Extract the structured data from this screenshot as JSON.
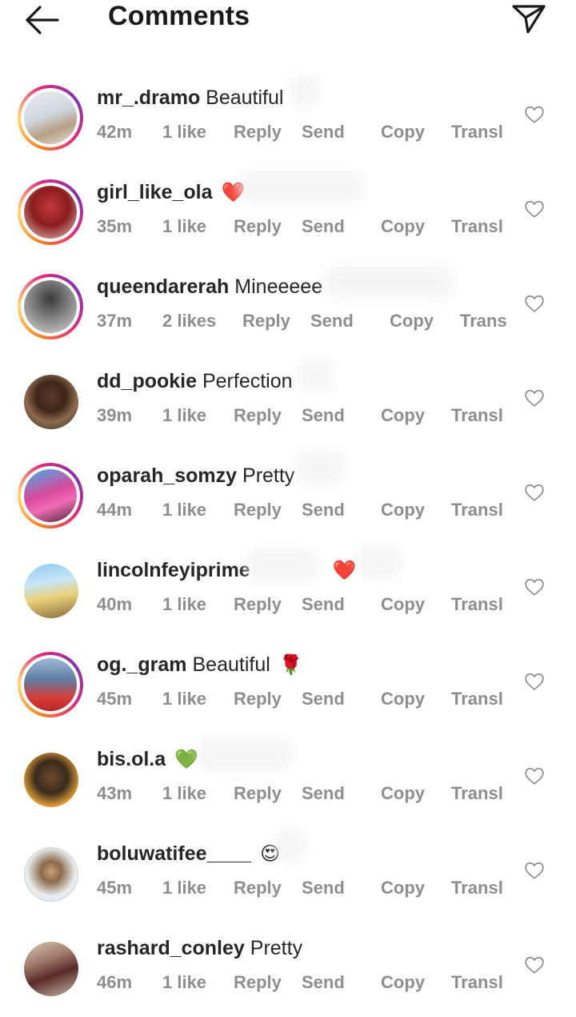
{
  "header": {
    "title": "Comments",
    "back_icon": "arrow-left-icon",
    "send_icon": "paper-plane-icon"
  },
  "actions": {
    "reply": "Reply",
    "send": "Send",
    "copy": "Copy",
    "translate": "Transl",
    "translate_short": "Trans"
  },
  "comments": [
    {
      "username": "mr_.dramo",
      "text": "Beautiful",
      "emoji": "",
      "time": "42m",
      "likes": "1 like"
    },
    {
      "username": "girl_like_ola",
      "text": "",
      "emoji": "❤️",
      "time": "35m",
      "likes": "1 like"
    },
    {
      "username": "queendarerah",
      "text": "Mineeeee",
      "emoji": "",
      "time": "37m",
      "likes": "2 likes"
    },
    {
      "username": "dd_pookie",
      "text": "Perfection",
      "emoji": "",
      "time": "39m",
      "likes": "1 like"
    },
    {
      "username": "oparah_somzy",
      "text": "Pretty",
      "emoji": "",
      "time": "44m",
      "likes": "1 like"
    },
    {
      "username": "lincolnfeyiprime",
      "text": "",
      "emoji": "❤️",
      "time": "40m",
      "likes": "1 like"
    },
    {
      "username": "og._gram",
      "text": "Beautiful",
      "emoji": "🌹",
      "time": "45m",
      "likes": "1 like"
    },
    {
      "username": "bis.ol.a",
      "text": "",
      "emoji": "💚",
      "time": "43m",
      "likes": "1 like"
    },
    {
      "username": "boluwatifee____",
      "text": "",
      "emoji": "😍",
      "time": "45m",
      "likes": "1 like"
    },
    {
      "username": "rashard_conley",
      "text": "Pretty",
      "emoji": "",
      "time": "46m",
      "likes": "1 like"
    }
  ],
  "colors": {
    "text_primary": "#262626",
    "text_secondary": "#8e8e8e",
    "story_ring_start": "#f58529",
    "story_ring_end": "#dd2a7b"
  }
}
